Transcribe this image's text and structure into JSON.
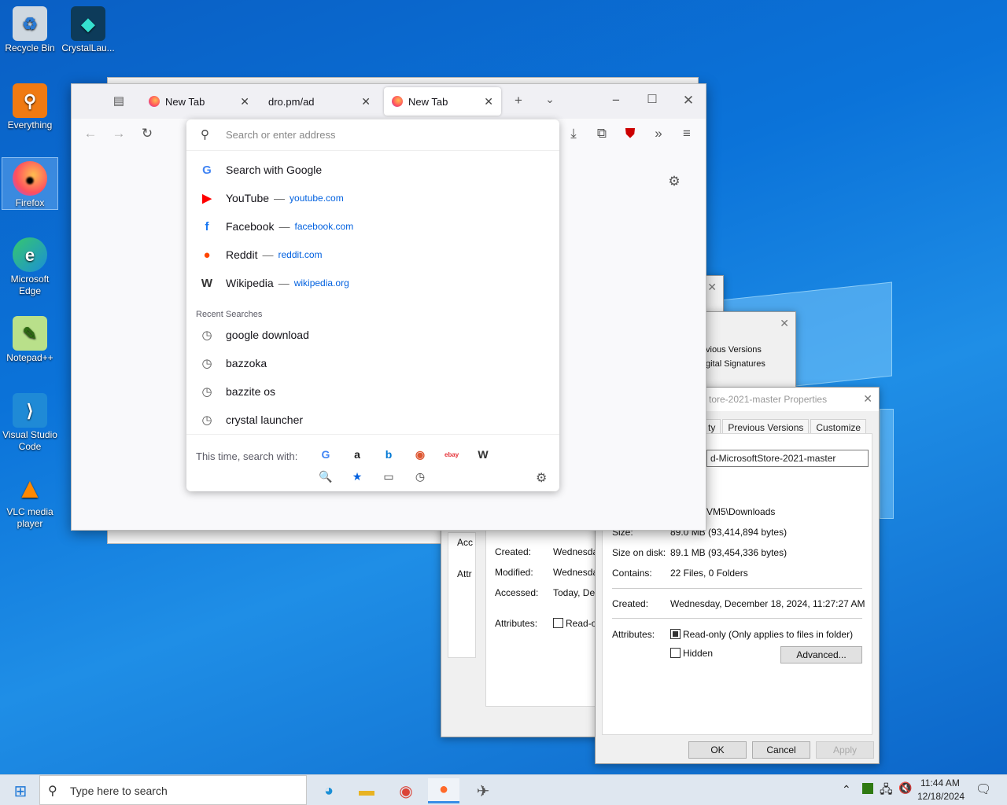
{
  "desktop": {
    "icons": [
      {
        "label": "Recycle Bin",
        "glyph": "♻"
      },
      {
        "label": "CrystalLau...",
        "glyph": "◆"
      },
      {
        "label": "Everything",
        "glyph": "⚲"
      },
      {
        "label": "Firefox",
        "glyph": "●"
      },
      {
        "label": "Microsoft Edge",
        "glyph": "e"
      },
      {
        "label": "Notepad++",
        "glyph": "✎"
      },
      {
        "label": "Visual Studio Code",
        "glyph": "⟩"
      },
      {
        "label": "VLC media player",
        "glyph": "▲"
      }
    ]
  },
  "dialogs": {
    "back": {
      "tab1": "vious Versions",
      "tab2": "gital Signatures"
    },
    "mid": {
      "created_label": "Created:",
      "created_value": "Wednesday",
      "modified_label": "Modified:",
      "modified_value": "Wednesday",
      "accessed_label": "Accessed:",
      "accessed_value": "Today, Dec",
      "attributes_label": "Attributes:",
      "readonly": "Read-or",
      "acc": "Acc",
      "attr": "Attr"
    },
    "front": {
      "title": "tore-2021-master Properties",
      "tabs": [
        "ty",
        "Previous Versions",
        "Customize"
      ],
      "name_value": "d-MicrosoftStore-2021-master",
      "location_value": "VM5\\Downloads",
      "size_label": "Size:",
      "size_value": "89.0 MB (93,414,894 bytes)",
      "sizeondisk_label": "Size on disk:",
      "sizeondisk_value": "89.1 MB (93,454,336 bytes)",
      "contains_label": "Contains:",
      "contains_value": "22 Files, 0 Folders",
      "created_label": "Created:",
      "created_value": "Wednesday, December 18, 2024, 11:27:27 AM",
      "attributes_label": "Attributes:",
      "readonly_label": "Read-only (Only applies to files in folder)",
      "hidden_label": "Hidden",
      "advanced_label": "Advanced...",
      "ok_label": "OK",
      "cancel_label": "Cancel",
      "apply_label": "Apply"
    }
  },
  "browser": {
    "tabs": [
      {
        "label": "New Tab"
      },
      {
        "label": "dro.pm/ad"
      },
      {
        "label": "New Tab"
      }
    ],
    "url_placeholder": "Search or enter address",
    "suggestions": [
      {
        "label": "Search with Google",
        "icon": "G",
        "url": "",
        "color": "#4285f4"
      },
      {
        "label": "YouTube",
        "icon": "▶",
        "url": "youtube.com",
        "color": "#ff0000"
      },
      {
        "label": "Facebook",
        "icon": "f",
        "url": "facebook.com",
        "color": "#1877f2"
      },
      {
        "label": "Reddit",
        "icon": "●",
        "url": "reddit.com",
        "color": "#ff4500"
      },
      {
        "label": "Wikipedia",
        "icon": "W",
        "url": "wikipedia.org",
        "color": "#333333"
      }
    ],
    "recent_header": "Recent Searches",
    "recent": [
      "google download",
      "bazzoka",
      "bazzite os",
      "crystal launcher"
    ],
    "search_with_label": "This time, search with:",
    "engines": [
      {
        "icon": "G",
        "color": "#4285f4"
      },
      {
        "icon": "a",
        "color": "#222222"
      },
      {
        "icon": "b",
        "color": "#0078d4"
      },
      {
        "icon": "◉",
        "color": "#de5833"
      },
      {
        "icon": "ebay",
        "color": "#e53238"
      },
      {
        "icon": "W",
        "color": "#333333"
      }
    ],
    "modes": [
      {
        "icon": "🔍",
        "color": "#0060df"
      },
      {
        "icon": "★",
        "color": "#0060df"
      },
      {
        "icon": "▭",
        "color": "#444444"
      },
      {
        "icon": "◷",
        "color": "#444444"
      }
    ],
    "separator": "—"
  },
  "taskbar": {
    "search_placeholder": "Type here to search",
    "time": "11:44 AM",
    "date": "12/18/2024"
  }
}
